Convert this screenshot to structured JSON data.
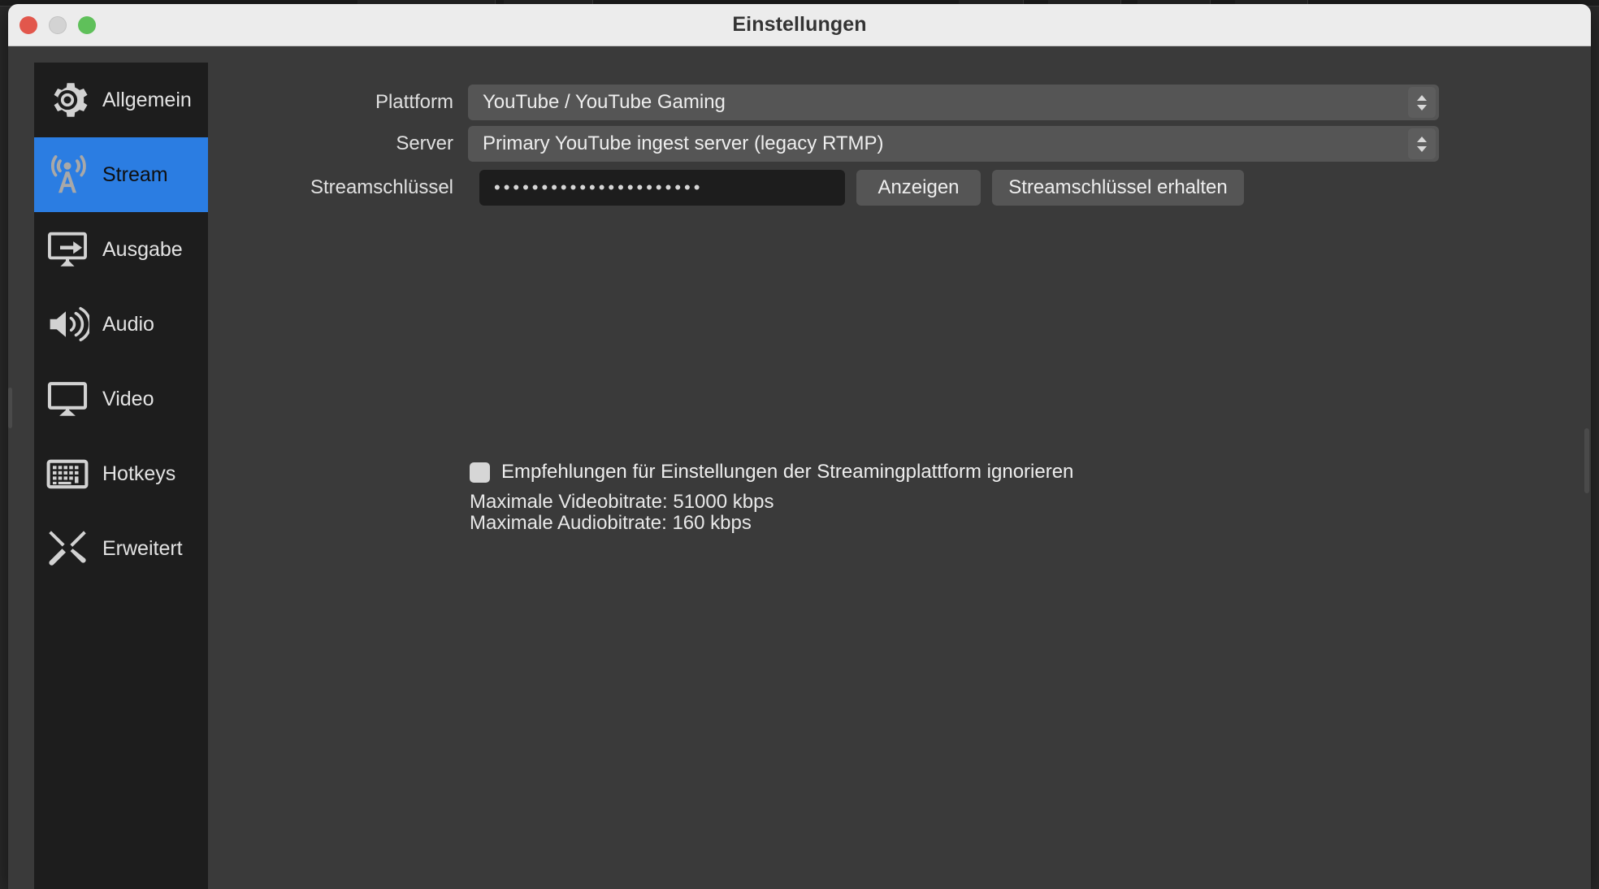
{
  "window": {
    "title": "Einstellungen",
    "traffic_lights": [
      {
        "name": "close",
        "color": "#e2574c"
      },
      {
        "name": "minimize",
        "color": "#d3d3d3"
      },
      {
        "name": "zoom",
        "color": "#5fc05a"
      }
    ]
  },
  "sidebar": {
    "items": [
      {
        "label": "Allgemein",
        "icon": "gear-icon",
        "selected": false
      },
      {
        "label": "Stream",
        "icon": "broadcast-tower-icon",
        "selected": true
      },
      {
        "label": "Ausgabe",
        "icon": "monitor-arrow-icon",
        "selected": false
      },
      {
        "label": "Audio",
        "icon": "speaker-icon",
        "selected": false
      },
      {
        "label": "Video",
        "icon": "monitor-icon",
        "selected": false
      },
      {
        "label": "Hotkeys",
        "icon": "keyboard-icon",
        "selected": false
      },
      {
        "label": "Erweitert",
        "icon": "tools-icon",
        "selected": false
      }
    ],
    "accent_color": "#2b7de2"
  },
  "form": {
    "platform": {
      "label": "Plattform",
      "value": "YouTube / YouTube Gaming"
    },
    "server": {
      "label": "Server",
      "value": "Primary YouTube ingest server (legacy RTMP)"
    },
    "stream_key": {
      "label": "Streamschlüssel",
      "value": "••••••••••••••••••••••",
      "show_button": "Anzeigen",
      "get_key_button": "Streamschlüssel erhalten"
    }
  },
  "options": {
    "ignore_recommendations": {
      "label": "Empfehlungen für Einstellungen der Streamingplattform ignorieren",
      "checked": false
    }
  },
  "info": {
    "max_video_bitrate": "Maximale Videobitrate: 51000 kbps",
    "max_audio_bitrate": "Maximale Audiobitrate: 160 kbps"
  }
}
